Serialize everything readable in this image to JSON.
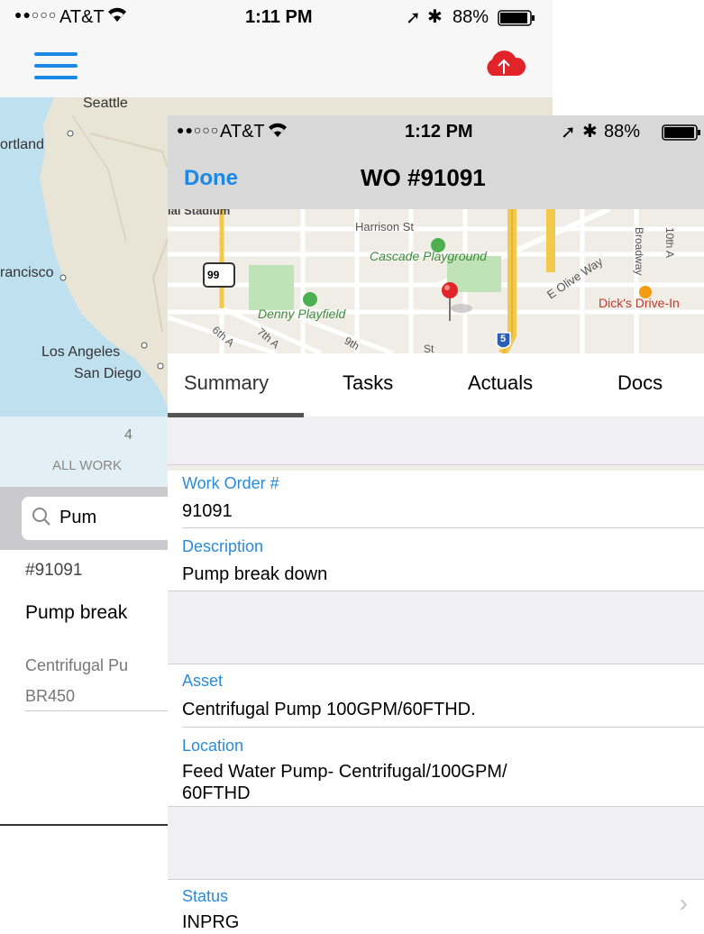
{
  "background_screen": {
    "status_bar": {
      "signal": "●●○○○",
      "carrier": "AT&T",
      "time": "1:11 PM",
      "battery": "88%"
    },
    "nav": {
      "menu_icon": "hamburger-icon",
      "upload_icon": "cloud-upload-icon",
      "upload_color": "#e0242a"
    },
    "map_labels": {
      "seattle": "Seattle",
      "portland": "ortland",
      "san_francisco": "rancisco",
      "los_angeles": "Los Angeles",
      "san_diego": "San Diego"
    },
    "filter": {
      "count": "4",
      "label": "ALL WORK"
    },
    "search": {
      "value": "Pum"
    },
    "list_item": {
      "id": "#91091",
      "title": "Pump break",
      "asset": "Centrifugal Pu",
      "location": "BR450"
    }
  },
  "modal": {
    "status_bar": {
      "signal": "●●○○○",
      "carrier": "AT&T",
      "time": "1:12 PM",
      "battery": "88%"
    },
    "nav": {
      "done_label": "Done",
      "title": "WO #91091"
    },
    "map_labels": {
      "stadium": "ial Stadium",
      "harrison": "Harrison St",
      "cascade": "Cascade Playground",
      "denny": "Denny Playfield",
      "olive": "E Olive Way",
      "dicks": "Dick's Drive-In",
      "broadway": "Broadway",
      "tenth": "10th A",
      "sixth": "6th A",
      "seventh": "7th A",
      "ninth": "9th",
      "st": "St",
      "route99": "99",
      "route5": "5"
    },
    "tabs": [
      {
        "label": "Summary"
      },
      {
        "label": "Tasks"
      },
      {
        "label": "Actuals"
      },
      {
        "label": "Docs"
      }
    ],
    "fields": {
      "work_order": {
        "label": "Work Order #",
        "value": "91091"
      },
      "description": {
        "label": "Description",
        "value": "Pump break down"
      },
      "asset": {
        "label": "Asset",
        "value": "Centrifugal Pump 100GPM/60FTHD."
      },
      "location": {
        "label": "Location",
        "value_line1": "Feed Water Pump- Centrifugal/100GPM/",
        "value_line2": "60FTHD"
      },
      "status": {
        "label": "Status",
        "value": "INPRG"
      }
    },
    "colors": {
      "accent": "#1a88e6",
      "label_blue": "#2a8ad8"
    }
  }
}
